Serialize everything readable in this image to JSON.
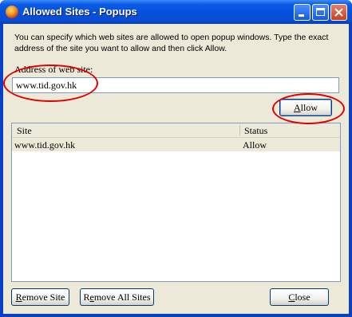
{
  "window": {
    "title": "Allowed Sites - Popups",
    "controls": {
      "minimize": "minimize-icon",
      "maximize": "maximize-icon",
      "close": "close-icon"
    }
  },
  "description": "You can specify which web sites are allowed to open popup windows. Type the exact address of the site you want to allow and then click Allow.",
  "address": {
    "label": "Address of web site:",
    "value": "www.tid.gov.hk"
  },
  "allow_button": {
    "label": "Allow",
    "accesskey": "A"
  },
  "list": {
    "columns": [
      "Site",
      "Status"
    ],
    "rows": [
      {
        "site": "www.tid.gov.hk",
        "status": "Allow"
      }
    ]
  },
  "buttons": {
    "remove_site": {
      "label": "Remove Site",
      "accesskey": "R"
    },
    "remove_all_sites": {
      "label": "Remove All Sites",
      "accesskey": "R"
    },
    "close": {
      "label": "Close",
      "accesskey": "C"
    }
  },
  "annotations": {
    "color": "#e00000"
  },
  "colors": {
    "titlebar": "#0550dd",
    "dialog_bg": "#ece9d8",
    "highlight": "#e00000"
  }
}
